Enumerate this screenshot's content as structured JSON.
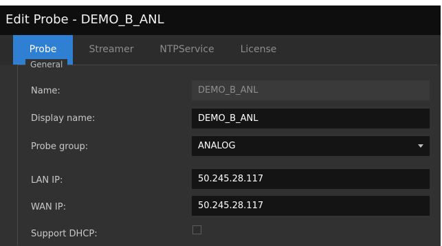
{
  "dialog": {
    "title": "Edit Probe - DEMO_B_ANL"
  },
  "tabs": [
    {
      "label": "Probe",
      "active": true
    },
    {
      "label": "Streamer",
      "active": false
    },
    {
      "label": "NTPService",
      "active": false
    },
    {
      "label": "License",
      "active": false
    }
  ],
  "general": {
    "legend": "General",
    "name": {
      "label": "Name:",
      "value": "DEMO_B_ANL",
      "disabled": true
    },
    "display_name": {
      "label": "Display name:",
      "value": "DEMO_B_ANL"
    },
    "probe_group": {
      "label": "Probe group:",
      "value": "ANALOG"
    },
    "lan_ip": {
      "label": "LAN IP:",
      "value": "50.245.28.117"
    },
    "wan_ip": {
      "label": "WAN IP:",
      "value": "50.245.28.117"
    },
    "support_dhcp": {
      "label": "Support DHCP:",
      "checked": false
    }
  },
  "colors": {
    "accent": "#2f7fd2",
    "background": "#313131",
    "titlebar": "#0e0e0e",
    "field": "#141414"
  }
}
